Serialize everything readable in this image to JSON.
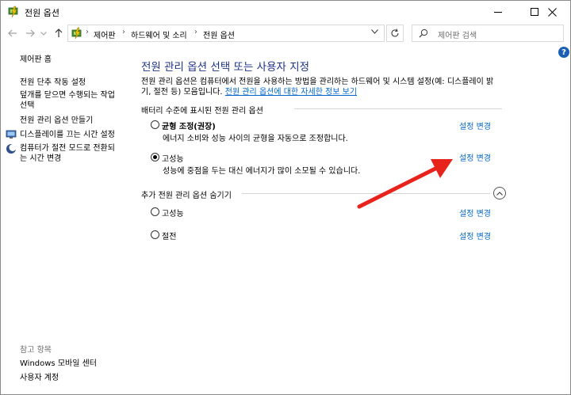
{
  "window": {
    "title": "전원 옵션"
  },
  "nav": {
    "breadcrumb": [
      "제어판",
      "하드웨어 및 소리",
      "전원 옵션"
    ],
    "search_placeholder": "제어판 검색"
  },
  "sidebar": {
    "items": [
      {
        "label": "제어판 홈"
      },
      {
        "label": "전원 단추 작동 설정"
      },
      {
        "label_lines": [
          "덮개를 닫으면 수행되는 작업",
          "선택"
        ]
      },
      {
        "label": "전원 관리 옵션 만들기"
      },
      {
        "label": "디스플레이를 끄는 시간 설정"
      },
      {
        "label_lines": [
          "컴퓨터가 절전 모드로 전환되",
          "는 시간 변경"
        ]
      }
    ],
    "references_heading": "참고 항목",
    "references": [
      {
        "label": "Windows 모바일 센터"
      },
      {
        "label": "사용자 계정"
      }
    ]
  },
  "main": {
    "title": "전원 관리 옵션 선택 또는 사용자 지정",
    "description_line1": "전원 관리 옵션은 컴퓨터에서 전원을 사용하는 방법을 관리하는 하드웨어 및 시스템 설정(예: 디스플레이 밝",
    "description_line2_prefix": "기, 절전 등) 모음입니다. ",
    "description_link": "전원 관리 옵션에 대한 자세한 정보 보기",
    "battery_group_heading": "배터리 수준에 표시된 전원 관리 옵션",
    "battery_plans": [
      {
        "name": "균형 조정(권장)",
        "description": "에너지 소비와 성능 사이의 균형을 자동으로 조정합니다.",
        "link": "설정 변경",
        "selected": false
      },
      {
        "name": "고성능",
        "description": "성능에 중점을 두는 대신 에너지가 많이 소모될 수 있습니다.",
        "link": "설정 변경",
        "selected": true
      }
    ],
    "hidden_group_heading": "추가 전원 관리 옵션 숨기기",
    "hidden_plans": [
      {
        "name": "고성능",
        "link": "설정 변경",
        "selected": false
      },
      {
        "name": "절전",
        "link": "설정 변경",
        "selected": false
      }
    ]
  },
  "colors": {
    "title_blue": "#1e3287",
    "link_blue": "#0066cc",
    "annotation_arrow": "#e8231c"
  }
}
